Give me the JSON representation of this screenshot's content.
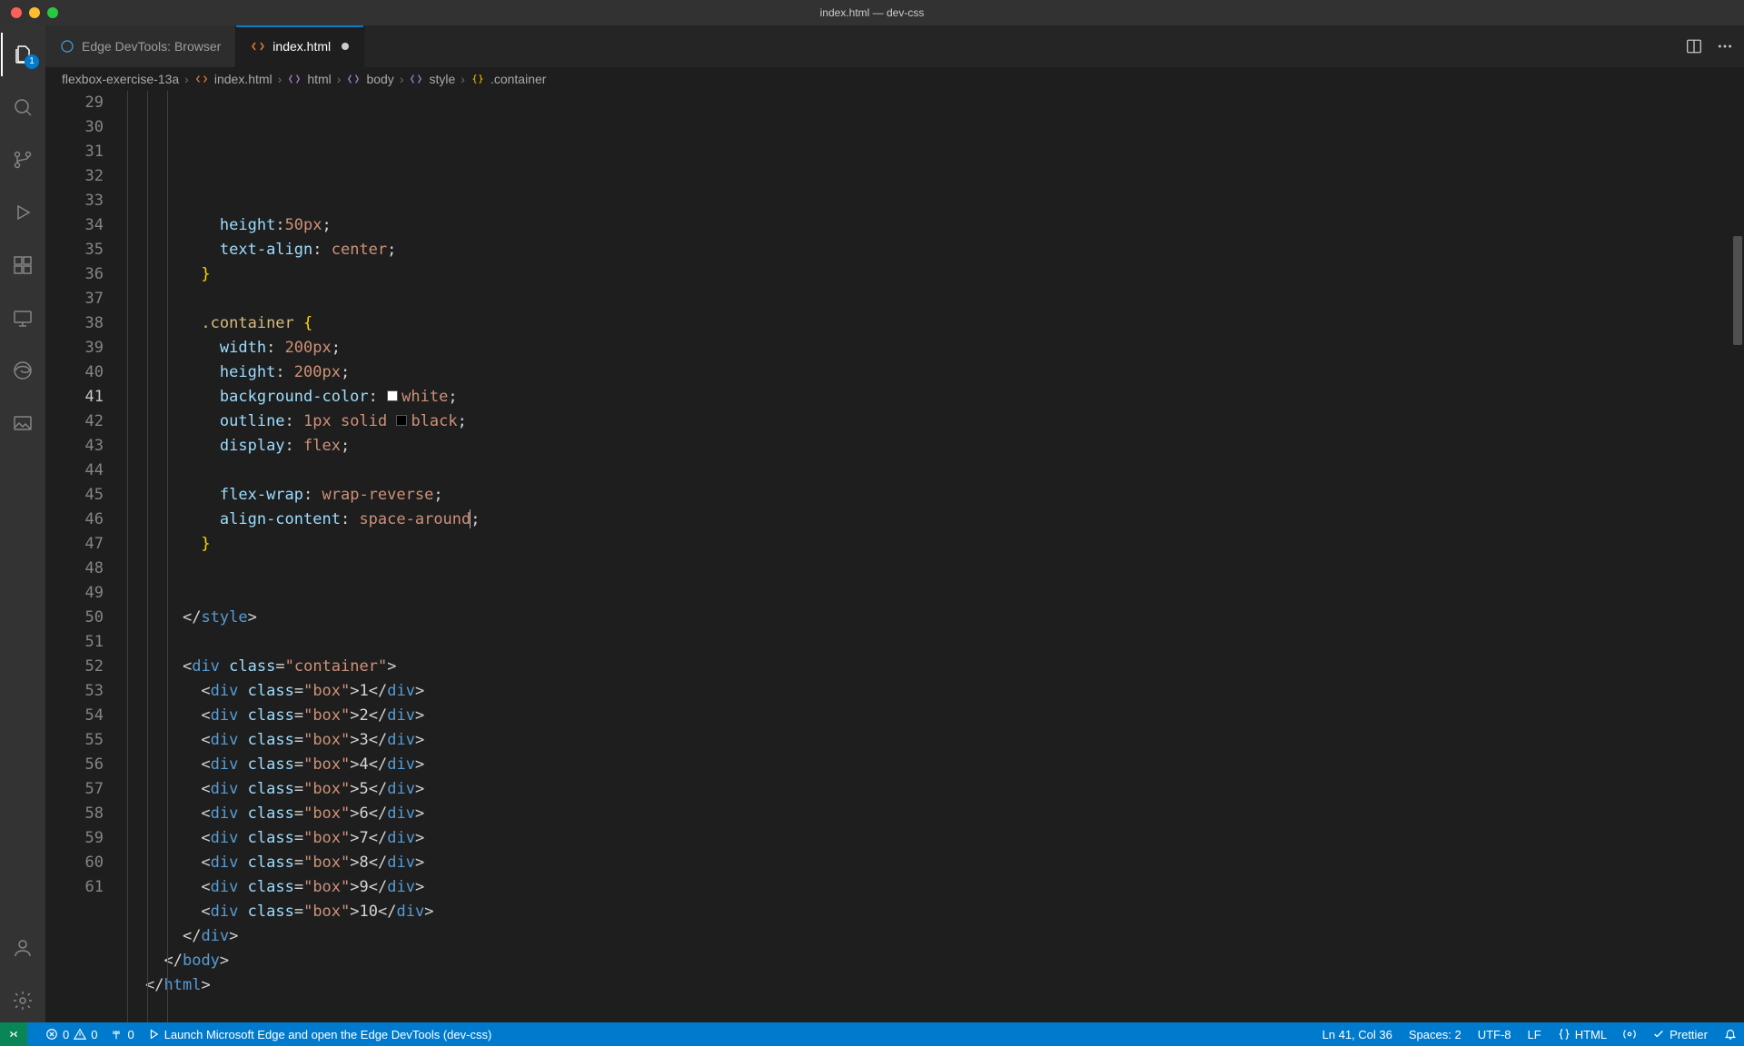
{
  "window": {
    "title": "index.html — dev-css"
  },
  "activity": {
    "explorer_badge": "1"
  },
  "tabs": {
    "items": [
      {
        "label": "Edge DevTools: Browser"
      },
      {
        "label": "index.html"
      }
    ],
    "active_index": 1
  },
  "breadcrumbs": {
    "parts": [
      "flexbox-exercise-13a",
      "index.html",
      "html",
      "body",
      "style",
      ".container"
    ]
  },
  "code": {
    "first_line": 29,
    "current_line": 41,
    "lines": [
      {
        "n": 29,
        "indent": 4,
        "tokens": [
          [
            "attr",
            "height"
          ],
          [
            "p",
            ":"
          ],
          [
            "v",
            "50px"
          ],
          [
            "p",
            ";"
          ]
        ]
      },
      {
        "n": 30,
        "indent": 4,
        "tokens": [
          [
            "attr",
            "text-align"
          ],
          [
            "p",
            ": "
          ],
          [
            "v",
            "center"
          ],
          [
            "p",
            ";"
          ]
        ]
      },
      {
        "n": 31,
        "indent": 3,
        "tokens": [
          [
            "brace",
            "}"
          ]
        ]
      },
      {
        "n": 32,
        "indent": 0,
        "tokens": []
      },
      {
        "n": 33,
        "indent": 3,
        "tokens": [
          [
            "sel",
            ".container"
          ],
          [
            "p",
            " "
          ],
          [
            "brace",
            "{"
          ]
        ]
      },
      {
        "n": 34,
        "indent": 4,
        "tokens": [
          [
            "attr",
            "width"
          ],
          [
            "p",
            ": "
          ],
          [
            "v",
            "200px"
          ],
          [
            "p",
            ";"
          ]
        ]
      },
      {
        "n": 35,
        "indent": 4,
        "tokens": [
          [
            "attr",
            "height"
          ],
          [
            "p",
            ": "
          ],
          [
            "v",
            "200px"
          ],
          [
            "p",
            ";"
          ]
        ]
      },
      {
        "n": 36,
        "indent": 4,
        "tokens": [
          [
            "attr",
            "background-color"
          ],
          [
            "p",
            ": "
          ],
          [
            "sw",
            "#ffffff"
          ],
          [
            "v",
            "white"
          ],
          [
            "p",
            ";"
          ]
        ]
      },
      {
        "n": 37,
        "indent": 4,
        "tokens": [
          [
            "attr",
            "outline"
          ],
          [
            "p",
            ": "
          ],
          [
            "v",
            "1px"
          ],
          [
            "p",
            " "
          ],
          [
            "v",
            "solid"
          ],
          [
            "p",
            " "
          ],
          [
            "sw",
            "#000000"
          ],
          [
            "v",
            "black"
          ],
          [
            "p",
            ";"
          ]
        ]
      },
      {
        "n": 38,
        "indent": 4,
        "tokens": [
          [
            "attr",
            "display"
          ],
          [
            "p",
            ": "
          ],
          [
            "v",
            "flex"
          ],
          [
            "p",
            ";"
          ]
        ]
      },
      {
        "n": 39,
        "indent": 0,
        "tokens": []
      },
      {
        "n": 40,
        "indent": 4,
        "tokens": [
          [
            "attr",
            "flex-wrap"
          ],
          [
            "p",
            ": "
          ],
          [
            "v",
            "wrap-reverse"
          ],
          [
            "p",
            ";"
          ]
        ]
      },
      {
        "n": 41,
        "indent": 4,
        "tokens": [
          [
            "attr",
            "align-content"
          ],
          [
            "p",
            ": "
          ],
          [
            "v",
            "space-around"
          ],
          [
            "cur",
            ""
          ],
          [
            "p",
            ";"
          ]
        ]
      },
      {
        "n": 42,
        "indent": 3,
        "tokens": [
          [
            "brace",
            "}"
          ]
        ]
      },
      {
        "n": 43,
        "indent": 0,
        "tokens": []
      },
      {
        "n": 44,
        "indent": 0,
        "tokens": []
      },
      {
        "n": 45,
        "indent": 2,
        "tokens": [
          [
            "p",
            "</"
          ],
          [
            "tag",
            "style"
          ],
          [
            "p",
            ">"
          ]
        ]
      },
      {
        "n": 46,
        "indent": 0,
        "tokens": []
      },
      {
        "n": 47,
        "indent": 2,
        "tokens": [
          [
            "p",
            "<"
          ],
          [
            "tag",
            "div"
          ],
          [
            "p",
            " "
          ],
          [
            "attr",
            "class"
          ],
          [
            "p",
            "="
          ],
          [
            "str",
            "\"container\""
          ],
          [
            "p",
            ">"
          ]
        ]
      },
      {
        "n": 48,
        "indent": 3,
        "tokens": [
          [
            "p",
            "<"
          ],
          [
            "tag",
            "div"
          ],
          [
            "p",
            " "
          ],
          [
            "attr",
            "class"
          ],
          [
            "p",
            "="
          ],
          [
            "str",
            "\"box\""
          ],
          [
            "p",
            ">"
          ],
          [
            "txt",
            "1"
          ],
          [
            "p",
            "</"
          ],
          [
            "tag",
            "div"
          ],
          [
            "p",
            ">"
          ]
        ]
      },
      {
        "n": 49,
        "indent": 3,
        "tokens": [
          [
            "p",
            "<"
          ],
          [
            "tag",
            "div"
          ],
          [
            "p",
            " "
          ],
          [
            "attr",
            "class"
          ],
          [
            "p",
            "="
          ],
          [
            "str",
            "\"box\""
          ],
          [
            "p",
            ">"
          ],
          [
            "txt",
            "2"
          ],
          [
            "p",
            "</"
          ],
          [
            "tag",
            "div"
          ],
          [
            "p",
            ">"
          ]
        ]
      },
      {
        "n": 50,
        "indent": 3,
        "tokens": [
          [
            "p",
            "<"
          ],
          [
            "tag",
            "div"
          ],
          [
            "p",
            " "
          ],
          [
            "attr",
            "class"
          ],
          [
            "p",
            "="
          ],
          [
            "str",
            "\"box\""
          ],
          [
            "p",
            ">"
          ],
          [
            "txt",
            "3"
          ],
          [
            "p",
            "</"
          ],
          [
            "tag",
            "div"
          ],
          [
            "p",
            ">"
          ]
        ]
      },
      {
        "n": 51,
        "indent": 3,
        "tokens": [
          [
            "p",
            "<"
          ],
          [
            "tag",
            "div"
          ],
          [
            "p",
            " "
          ],
          [
            "attr",
            "class"
          ],
          [
            "p",
            "="
          ],
          [
            "str",
            "\"box\""
          ],
          [
            "p",
            ">"
          ],
          [
            "txt",
            "4"
          ],
          [
            "p",
            "</"
          ],
          [
            "tag",
            "div"
          ],
          [
            "p",
            ">"
          ]
        ]
      },
      {
        "n": 52,
        "indent": 3,
        "tokens": [
          [
            "p",
            "<"
          ],
          [
            "tag",
            "div"
          ],
          [
            "p",
            " "
          ],
          [
            "attr",
            "class"
          ],
          [
            "p",
            "="
          ],
          [
            "str",
            "\"box\""
          ],
          [
            "p",
            ">"
          ],
          [
            "txt",
            "5"
          ],
          [
            "p",
            "</"
          ],
          [
            "tag",
            "div"
          ],
          [
            "p",
            ">"
          ]
        ]
      },
      {
        "n": 53,
        "indent": 3,
        "tokens": [
          [
            "p",
            "<"
          ],
          [
            "tag",
            "div"
          ],
          [
            "p",
            " "
          ],
          [
            "attr",
            "class"
          ],
          [
            "p",
            "="
          ],
          [
            "str",
            "\"box\""
          ],
          [
            "p",
            ">"
          ],
          [
            "txt",
            "6"
          ],
          [
            "p",
            "</"
          ],
          [
            "tag",
            "div"
          ],
          [
            "p",
            ">"
          ]
        ]
      },
      {
        "n": 54,
        "indent": 3,
        "tokens": [
          [
            "p",
            "<"
          ],
          [
            "tag",
            "div"
          ],
          [
            "p",
            " "
          ],
          [
            "attr",
            "class"
          ],
          [
            "p",
            "="
          ],
          [
            "str",
            "\"box\""
          ],
          [
            "p",
            ">"
          ],
          [
            "txt",
            "7"
          ],
          [
            "p",
            "</"
          ],
          [
            "tag",
            "div"
          ],
          [
            "p",
            ">"
          ]
        ]
      },
      {
        "n": 55,
        "indent": 3,
        "tokens": [
          [
            "p",
            "<"
          ],
          [
            "tag",
            "div"
          ],
          [
            "p",
            " "
          ],
          [
            "attr",
            "class"
          ],
          [
            "p",
            "="
          ],
          [
            "str",
            "\"box\""
          ],
          [
            "p",
            ">"
          ],
          [
            "txt",
            "8"
          ],
          [
            "p",
            "</"
          ],
          [
            "tag",
            "div"
          ],
          [
            "p",
            ">"
          ]
        ]
      },
      {
        "n": 56,
        "indent": 3,
        "tokens": [
          [
            "p",
            "<"
          ],
          [
            "tag",
            "div"
          ],
          [
            "p",
            " "
          ],
          [
            "attr",
            "class"
          ],
          [
            "p",
            "="
          ],
          [
            "str",
            "\"box\""
          ],
          [
            "p",
            ">"
          ],
          [
            "txt",
            "9"
          ],
          [
            "p",
            "</"
          ],
          [
            "tag",
            "div"
          ],
          [
            "p",
            ">"
          ]
        ]
      },
      {
        "n": 57,
        "indent": 3,
        "tokens": [
          [
            "p",
            "<"
          ],
          [
            "tag",
            "div"
          ],
          [
            "p",
            " "
          ],
          [
            "attr",
            "class"
          ],
          [
            "p",
            "="
          ],
          [
            "str",
            "\"box\""
          ],
          [
            "p",
            ">"
          ],
          [
            "txt",
            "10"
          ],
          [
            "p",
            "</"
          ],
          [
            "tag",
            "div"
          ],
          [
            "p",
            ">"
          ]
        ]
      },
      {
        "n": 58,
        "indent": 2,
        "tokens": [
          [
            "p",
            "</"
          ],
          [
            "tag",
            "div"
          ],
          [
            "p",
            ">"
          ]
        ]
      },
      {
        "n": 59,
        "indent": 1,
        "tokens": [
          [
            "p",
            "</"
          ],
          [
            "tag",
            "body"
          ],
          [
            "p",
            ">"
          ]
        ]
      },
      {
        "n": 60,
        "indent": 0,
        "tokens": [
          [
            "p",
            "</"
          ],
          [
            "tag",
            "html"
          ],
          [
            "p",
            ">"
          ]
        ]
      },
      {
        "n": 61,
        "indent": 0,
        "tokens": []
      }
    ]
  },
  "status": {
    "errors": "0",
    "warnings": "0",
    "ports": "0",
    "launch": "Launch Microsoft Edge and open the Edge DevTools (dev-css)",
    "lncol": "Ln 41, Col 36",
    "spaces": "Spaces: 2",
    "encoding": "UTF-8",
    "eol": "LF",
    "lang": "HTML",
    "prettier": "Prettier"
  }
}
